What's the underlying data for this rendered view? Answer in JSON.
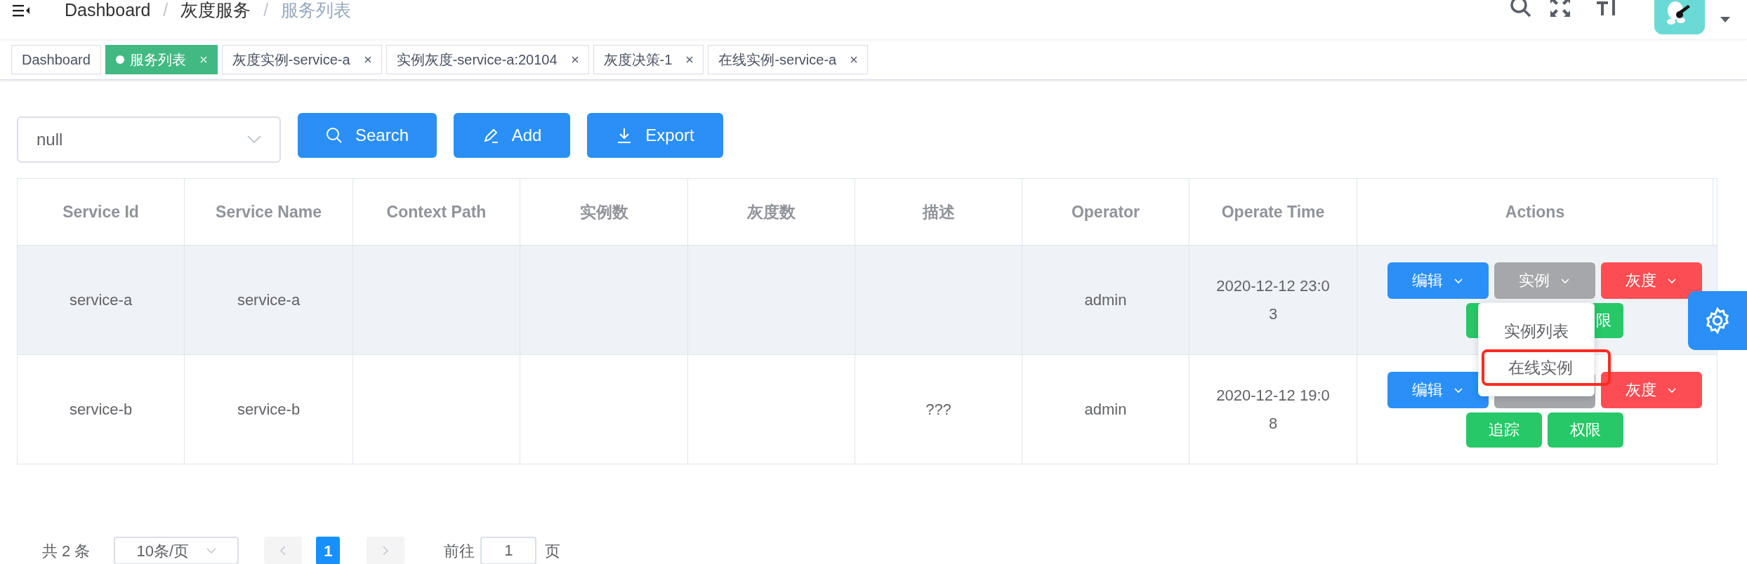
{
  "breadcrumb": [
    "Dashboard",
    "灰度服务",
    "服务列表"
  ],
  "breadcrumb_separator": "/",
  "tags": [
    {
      "label": "Dashboard",
      "selected": false,
      "closable": false
    },
    {
      "label": "服务列表",
      "selected": true,
      "closable": true
    },
    {
      "label": "灰度实例-service-a",
      "selected": false,
      "closable": true
    },
    {
      "label": "实例灰度-service-a:20104",
      "selected": false,
      "closable": true
    },
    {
      "label": "灰度决策-1",
      "selected": false,
      "closable": true
    },
    {
      "label": "在线实例-service-a",
      "selected": false,
      "closable": true
    }
  ],
  "filter": {
    "value": "null"
  },
  "toolbar": [
    {
      "label": "Search",
      "kind": "search"
    },
    {
      "label": "Add",
      "kind": "add"
    },
    {
      "label": "Export",
      "kind": "export"
    }
  ],
  "table": {
    "columns": [
      "Service Id",
      "Service Name",
      "Context Path",
      "实例数",
      "灰度数",
      "描述",
      "Operator",
      "Operate Time",
      "Actions"
    ],
    "rows": [
      {
        "service_id": "service-a",
        "service_name": "service-a",
        "operator": "admin",
        "operate_time": "2020-12-12 23:03",
        "hovered": true,
        "actions": [
          [
            {
              "label": "编辑",
              "color": "#2a8ff7",
              "dropdown": true
            },
            {
              "label": "实例",
              "color": "#a5a7aa",
              "dropdown": true
            },
            {
              "label": "灰度",
              "color": "#fd4d54",
              "dropdown": true
            }
          ],
          [
            {
              "color": "#27c867"
            },
            {
              "label": "限",
              "color": "#27c867"
            }
          ]
        ]
      },
      {
        "service_id": "service-b",
        "service_name": "service-b",
        "description": "???",
        "operator": "admin",
        "operate_time": "2020-12-12 19:08",
        "hovered": false,
        "actions": [
          [
            {
              "label": "编辑",
              "color": "#2a8ff7",
              "dropdown": true
            },
            {
              "color": "#a5a7aa",
              "dropdown": false
            },
            {
              "label": "灰度",
              "color": "#fd4d54",
              "dropdown": true
            }
          ],
          [
            {
              "label": "追踪",
              "color": "#27c867"
            },
            {
              "label": "权限",
              "color": "#27c867"
            }
          ]
        ]
      }
    ]
  },
  "dropdown_menu": [
    {
      "label": "实例列表",
      "highlighted": false
    },
    {
      "label": "在线实例",
      "highlighted": true
    }
  ],
  "pagination": {
    "total": "共 2 条",
    "page_size": "10条/页",
    "pages": [
      {
        "label": "1",
        "selected": true
      }
    ],
    "goto_label": "前往",
    "goto_value": "1",
    "goto_suffix": "页"
  }
}
